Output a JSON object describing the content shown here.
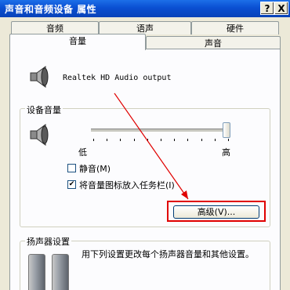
{
  "window": {
    "title": "声音和音频设备 属性",
    "help_btn": "?",
    "close_btn": "X"
  },
  "tabs": {
    "row1": [
      "音频",
      "语声",
      "硬件"
    ],
    "row2": [
      "音量",
      "声音"
    ],
    "active": "音量"
  },
  "device": {
    "name": "Realtek HD Audio output"
  },
  "device_volume": {
    "group_label": "设备音量",
    "slider_low": "低",
    "slider_high": "高",
    "slider_level": 1.0,
    "mute_label": "静音(M)",
    "mute_checked": false,
    "tray_label": "将音量图标放入任务栏(I)",
    "tray_checked": true,
    "advanced_button": "高级(V)..."
  },
  "speaker_settings": {
    "group_label": "扬声器设置",
    "description": "用下列设置更改每个扬声器音量和其他设置。"
  },
  "annotation": {
    "color": "#e00000"
  }
}
